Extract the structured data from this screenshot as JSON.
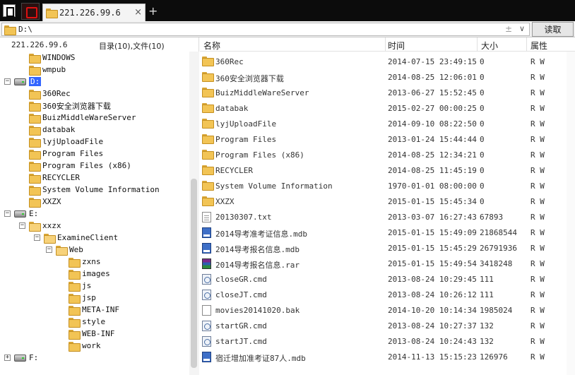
{
  "tab": {
    "title": "221.226.99.6",
    "close_label": "×",
    "new_tab_label": "+"
  },
  "pathbar": {
    "value": "D:\\",
    "extra_glyph": "±",
    "dropdown_glyph": "∨",
    "read_button": "读取"
  },
  "left": {
    "host": "221.226.99.6",
    "summary": "目录(10),文件(10)",
    "tree": [
      {
        "label": "WINDOWS",
        "type": "folder",
        "depth": 2
      },
      {
        "label": "wmpub",
        "type": "folder",
        "depth": 2
      },
      {
        "label": "D:",
        "type": "drive",
        "depth": 0,
        "expanded": true,
        "selected": true
      },
      {
        "label": "360Rec",
        "type": "folder",
        "depth": 2
      },
      {
        "label": "360安全浏览器下载",
        "type": "folder",
        "depth": 2
      },
      {
        "label": "BuizMiddleWareServer",
        "type": "folder",
        "depth": 2
      },
      {
        "label": "databak",
        "type": "folder",
        "depth": 2
      },
      {
        "label": "lyjUploadFile",
        "type": "folder",
        "depth": 2
      },
      {
        "label": "Program Files",
        "type": "folder",
        "depth": 2
      },
      {
        "label": "Program Files (x86)",
        "type": "folder",
        "depth": 2
      },
      {
        "label": "RECYCLER",
        "type": "folder",
        "depth": 2
      },
      {
        "label": "System Volume Information",
        "type": "folder",
        "depth": 2
      },
      {
        "label": "XXZX",
        "type": "folder",
        "depth": 2
      },
      {
        "label": "E:",
        "type": "drive",
        "depth": 0,
        "expanded": true
      },
      {
        "label": "xxzx",
        "type": "folder",
        "depth": 1,
        "expanded": true
      },
      {
        "label": "ExamineClient",
        "type": "folder",
        "depth": 2,
        "expanded": true
      },
      {
        "label": "Web",
        "type": "folder",
        "depth": 3,
        "expanded": true
      },
      {
        "label": "zxns",
        "type": "folder",
        "depth": 4
      },
      {
        "label": "images",
        "type": "folder",
        "depth": 4
      },
      {
        "label": "js",
        "type": "folder",
        "depth": 4
      },
      {
        "label": "jsp",
        "type": "folder",
        "depth": 4
      },
      {
        "label": "META-INF",
        "type": "folder",
        "depth": 4
      },
      {
        "label": "style",
        "type": "folder",
        "depth": 4
      },
      {
        "label": "WEB-INF",
        "type": "folder",
        "depth": 4
      },
      {
        "label": "work",
        "type": "folder",
        "depth": 4
      },
      {
        "label": "F:",
        "type": "drive",
        "depth": 0
      }
    ]
  },
  "columns": {
    "name": "名称",
    "time": "时间",
    "size": "大小",
    "attr": "属性"
  },
  "files": [
    {
      "name": "360Rec",
      "time": "2014-07-15 23:49:15",
      "size": "0",
      "attr": "R W",
      "icon": "folder"
    },
    {
      "name": "360安全浏览器下载",
      "time": "2014-08-25 12:06:01",
      "size": "0",
      "attr": "R W",
      "icon": "folder"
    },
    {
      "name": "BuizMiddleWareServer",
      "time": "2013-06-27 15:52:45",
      "size": "0",
      "attr": "R W",
      "icon": "folder"
    },
    {
      "name": "databak",
      "time": "2015-02-27 00:00:25",
      "size": "0",
      "attr": "R W",
      "icon": "folder"
    },
    {
      "name": "lyjUploadFile",
      "time": "2014-09-10 08:22:50",
      "size": "0",
      "attr": "R W",
      "icon": "folder"
    },
    {
      "name": "Program Files",
      "time": "2013-01-24 15:44:44",
      "size": "0",
      "attr": "R W",
      "icon": "folder"
    },
    {
      "name": "Program Files (x86)",
      "time": "2014-08-25 12:34:21",
      "size": "0",
      "attr": "R W",
      "icon": "folder"
    },
    {
      "name": "RECYCLER",
      "time": "2014-08-25 11:45:19",
      "size": "0",
      "attr": "R W",
      "icon": "folder"
    },
    {
      "name": "System Volume Information",
      "time": "1970-01-01 08:00:00",
      "size": "0",
      "attr": "R W",
      "icon": "folder"
    },
    {
      "name": "XXZX",
      "time": "2015-01-15 15:45:34",
      "size": "0",
      "attr": "R W",
      "icon": "folder"
    },
    {
      "name": "20130307.txt",
      "time": "2013-03-07 16:27:43",
      "size": "67893",
      "attr": "R W",
      "icon": "txt"
    },
    {
      "name": "2014导考准考证信息.mdb",
      "time": "2015-01-15 15:49:09",
      "size": "21868544",
      "attr": "R W",
      "icon": "mdb"
    },
    {
      "name": "2014导考报名信息.mdb",
      "time": "2015-01-15 15:45:29",
      "size": "26791936",
      "attr": "R W",
      "icon": "mdb"
    },
    {
      "name": "2014导考报名信息.rar",
      "time": "2015-01-15 15:49:54",
      "size": "3418248",
      "attr": "R W",
      "icon": "rar"
    },
    {
      "name": "closeGR.cmd",
      "time": "2013-08-24 10:29:45",
      "size": "111",
      "attr": "R W",
      "icon": "cmd"
    },
    {
      "name": "closeJT.cmd",
      "time": "2013-08-24 10:26:12",
      "size": "111",
      "attr": "R W",
      "icon": "cmd"
    },
    {
      "name": "movies20141020.bak",
      "time": "2014-10-20 10:14:34",
      "size": "1985024",
      "attr": "R W",
      "icon": "blank"
    },
    {
      "name": "startGR.cmd",
      "time": "2013-08-24 10:27:37",
      "size": "132",
      "attr": "R W",
      "icon": "cmd"
    },
    {
      "name": "startJT.cmd",
      "time": "2013-08-24 10:24:43",
      "size": "132",
      "attr": "R W",
      "icon": "cmd"
    },
    {
      "name": "宿迁增加准考证87人.mdb",
      "time": "2014-11-13 15:15:23",
      "size": "126976",
      "attr": "R W",
      "icon": "mdb"
    }
  ]
}
